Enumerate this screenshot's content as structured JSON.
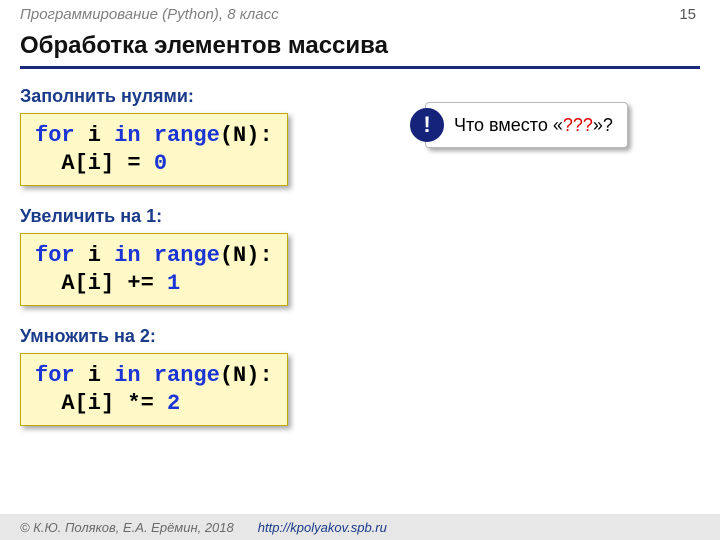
{
  "header": {
    "breadcrumb": "Программирование (Python), 8 класс",
    "page_number": "15"
  },
  "title": "Обработка элементов массива",
  "sections": [
    {
      "subhead": "Заполнить нулями:",
      "code": {
        "l1a": "for",
        "l1b": " i ",
        "l1c": "in",
        "l1d": " ",
        "l1e": "range",
        "l1f": "(N):",
        "l2a": "  A[i] = ",
        "l2b": "0"
      }
    },
    {
      "subhead": "Увеличить на 1:",
      "code": {
        "l1a": "for",
        "l1b": " i ",
        "l1c": "in",
        "l1d": " ",
        "l1e": "range",
        "l1f": "(N):",
        "l2a": "  A[i] += ",
        "l2b": "1"
      }
    },
    {
      "subhead": "Умножить на 2:",
      "code": {
        "l1a": "for",
        "l1b": " i ",
        "l1c": "in",
        "l1d": " ",
        "l1e": "range",
        "l1f": "(N):",
        "l2a": "  A[i] *= ",
        "l2b": "2"
      }
    }
  ],
  "callout": {
    "badge": "!",
    "prefix": "Что вместо «",
    "hilite": "???",
    "suffix": "»?"
  },
  "footer": {
    "copyright": "© К.Ю. Поляков, Е.А. Ерёмин, 2018",
    "url": "http://kpolyakov.spb.ru"
  }
}
